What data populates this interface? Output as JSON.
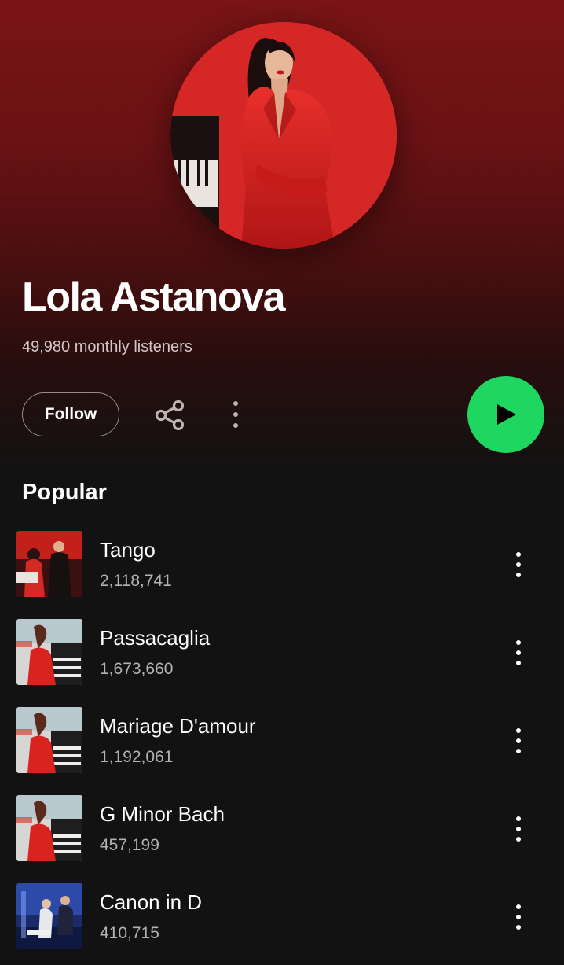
{
  "artist": {
    "name": "Lola Astanova",
    "listeners": "49,980 monthly listeners"
  },
  "actions": {
    "follow_label": "Follow",
    "share_icon": "share-icon",
    "more_icon": "vertical-dots-icon",
    "play_icon": "play-icon"
  },
  "colors": {
    "accent": "#1ed760",
    "header": "#7a1416",
    "background": "#121212"
  },
  "popular": {
    "title": "Popular",
    "tracks": [
      {
        "title": "Tango",
        "plays": "2,118,741"
      },
      {
        "title": "Passacaglia",
        "plays": "1,673,660"
      },
      {
        "title": "Mariage D'amour",
        "plays": "1,192,061"
      },
      {
        "title": "G Minor Bach",
        "plays": "457,199"
      },
      {
        "title": "Canon in D",
        "plays": "410,715"
      }
    ]
  }
}
